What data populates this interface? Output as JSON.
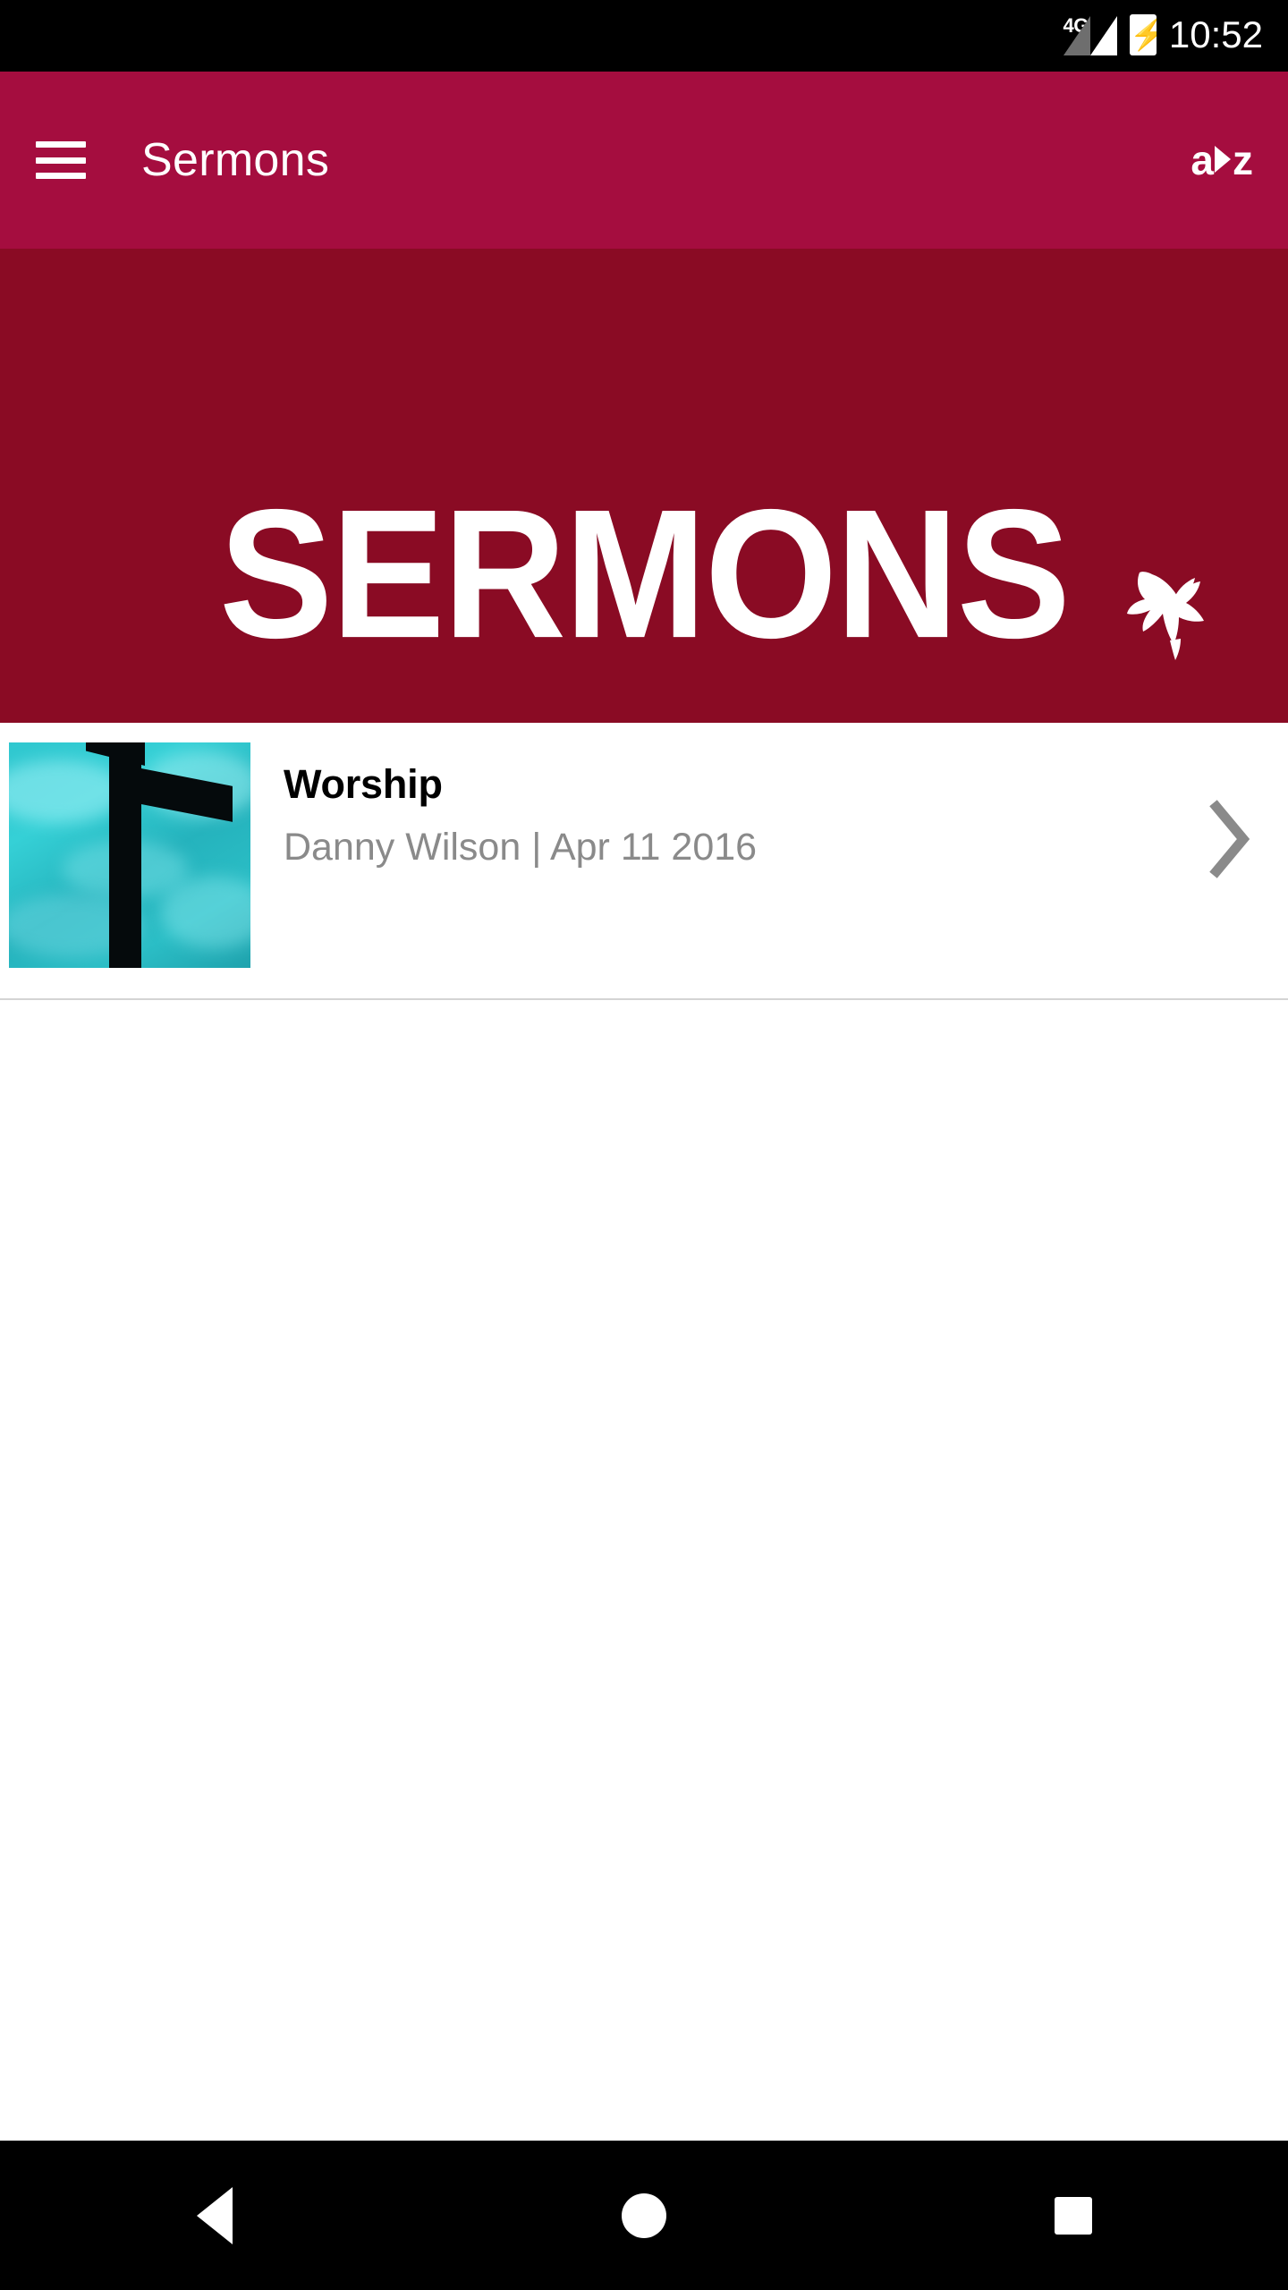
{
  "status_bar": {
    "network_label": "4G",
    "signal_icon": "signal-bars-icon",
    "battery_icon": "battery-charging-icon",
    "battery_bolt": "⚡",
    "time": "10:52"
  },
  "app_bar": {
    "menu_icon": "hamburger-menu-icon",
    "title": "Sermons",
    "logo": {
      "left": "a",
      "chevron": "chevron-right-icon",
      "right": "z",
      "full_text": "a>z"
    },
    "background_color": "#a50d3f"
  },
  "banner": {
    "wordmark": "SERMONS",
    "dove_icon": "dove-icon",
    "background_color": "#8a0b24",
    "text_color": "#ffffff"
  },
  "list": {
    "items": [
      {
        "thumbnail_icon": "cross-silhouette-thumbnail",
        "title": "Worship",
        "subtitle": "Danny Wilson | Apr 11 2016",
        "speaker": "Danny Wilson",
        "date": "Apr 11 2016",
        "chevron_icon": "chevron-right-icon"
      }
    ]
  },
  "nav_bar": {
    "back_label": "back-icon",
    "home_label": "home-icon",
    "recents_label": "recents-icon"
  }
}
